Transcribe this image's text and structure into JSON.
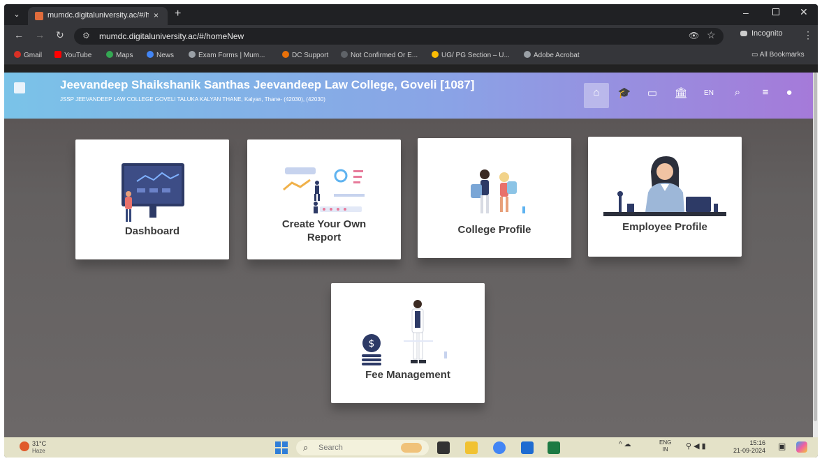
{
  "browser": {
    "tab_title": "mumdc.digitaluniversity.ac/#/h",
    "tab_close": "×",
    "new_tab": "+",
    "url": "mumdc.digitaluniversity.ac/#/homeNew",
    "incognito_label": "Incognito",
    "window": {
      "minimize": "–",
      "close": "✕"
    }
  },
  "bookmarks": [
    {
      "label": "Gmail",
      "color": "#d93025"
    },
    {
      "label": "YouTube",
      "color": "#ff0000"
    },
    {
      "label": "Maps",
      "color": "#34a853"
    },
    {
      "label": "News",
      "color": "#4285f4"
    },
    {
      "label": "Exam Forms | Mum...",
      "color": "#9aa0a6"
    },
    {
      "label": "DC Support",
      "color": "#e8710a"
    },
    {
      "label": "Not Confirmed Or E...",
      "color": "#5f6368"
    },
    {
      "label": "UG/ PG Section – U...",
      "color": "#fbbc04"
    },
    {
      "label": "Adobe Acrobat",
      "color": "#9aa0a6"
    }
  ],
  "all_bookmarks": "All Bookmarks",
  "header": {
    "title": "Jeevandeep Shaikshanik Santhas Jeevandeep Law College, Goveli [1087]",
    "subtitle": "JSSP JEEVANDEEP LAW COLLEGE GOVELI TALUKA KALYAN THANE, Kalyan, Thane- (42030), (42030)",
    "lang": "EN",
    "icons": [
      "home-icon",
      "graduation-cap-icon",
      "monitor-icon",
      "bank-icon",
      "language-icon",
      "search-icon",
      "menu-icon",
      "user-icon"
    ]
  },
  "cards": {
    "dashboard": "Dashboard",
    "report_line1": "Create Your Own",
    "report_line2": "Report",
    "college_profile": "College Profile",
    "employee_profile": "Employee Profile",
    "fee_management": "Fee Management"
  },
  "taskbar": {
    "weather_temp": "31°C",
    "weather_desc": "Haze",
    "search_placeholder": "Search",
    "lang_line1": "ENG",
    "lang_line2": "IN",
    "time": "15:16",
    "date": "21-09-2024"
  }
}
